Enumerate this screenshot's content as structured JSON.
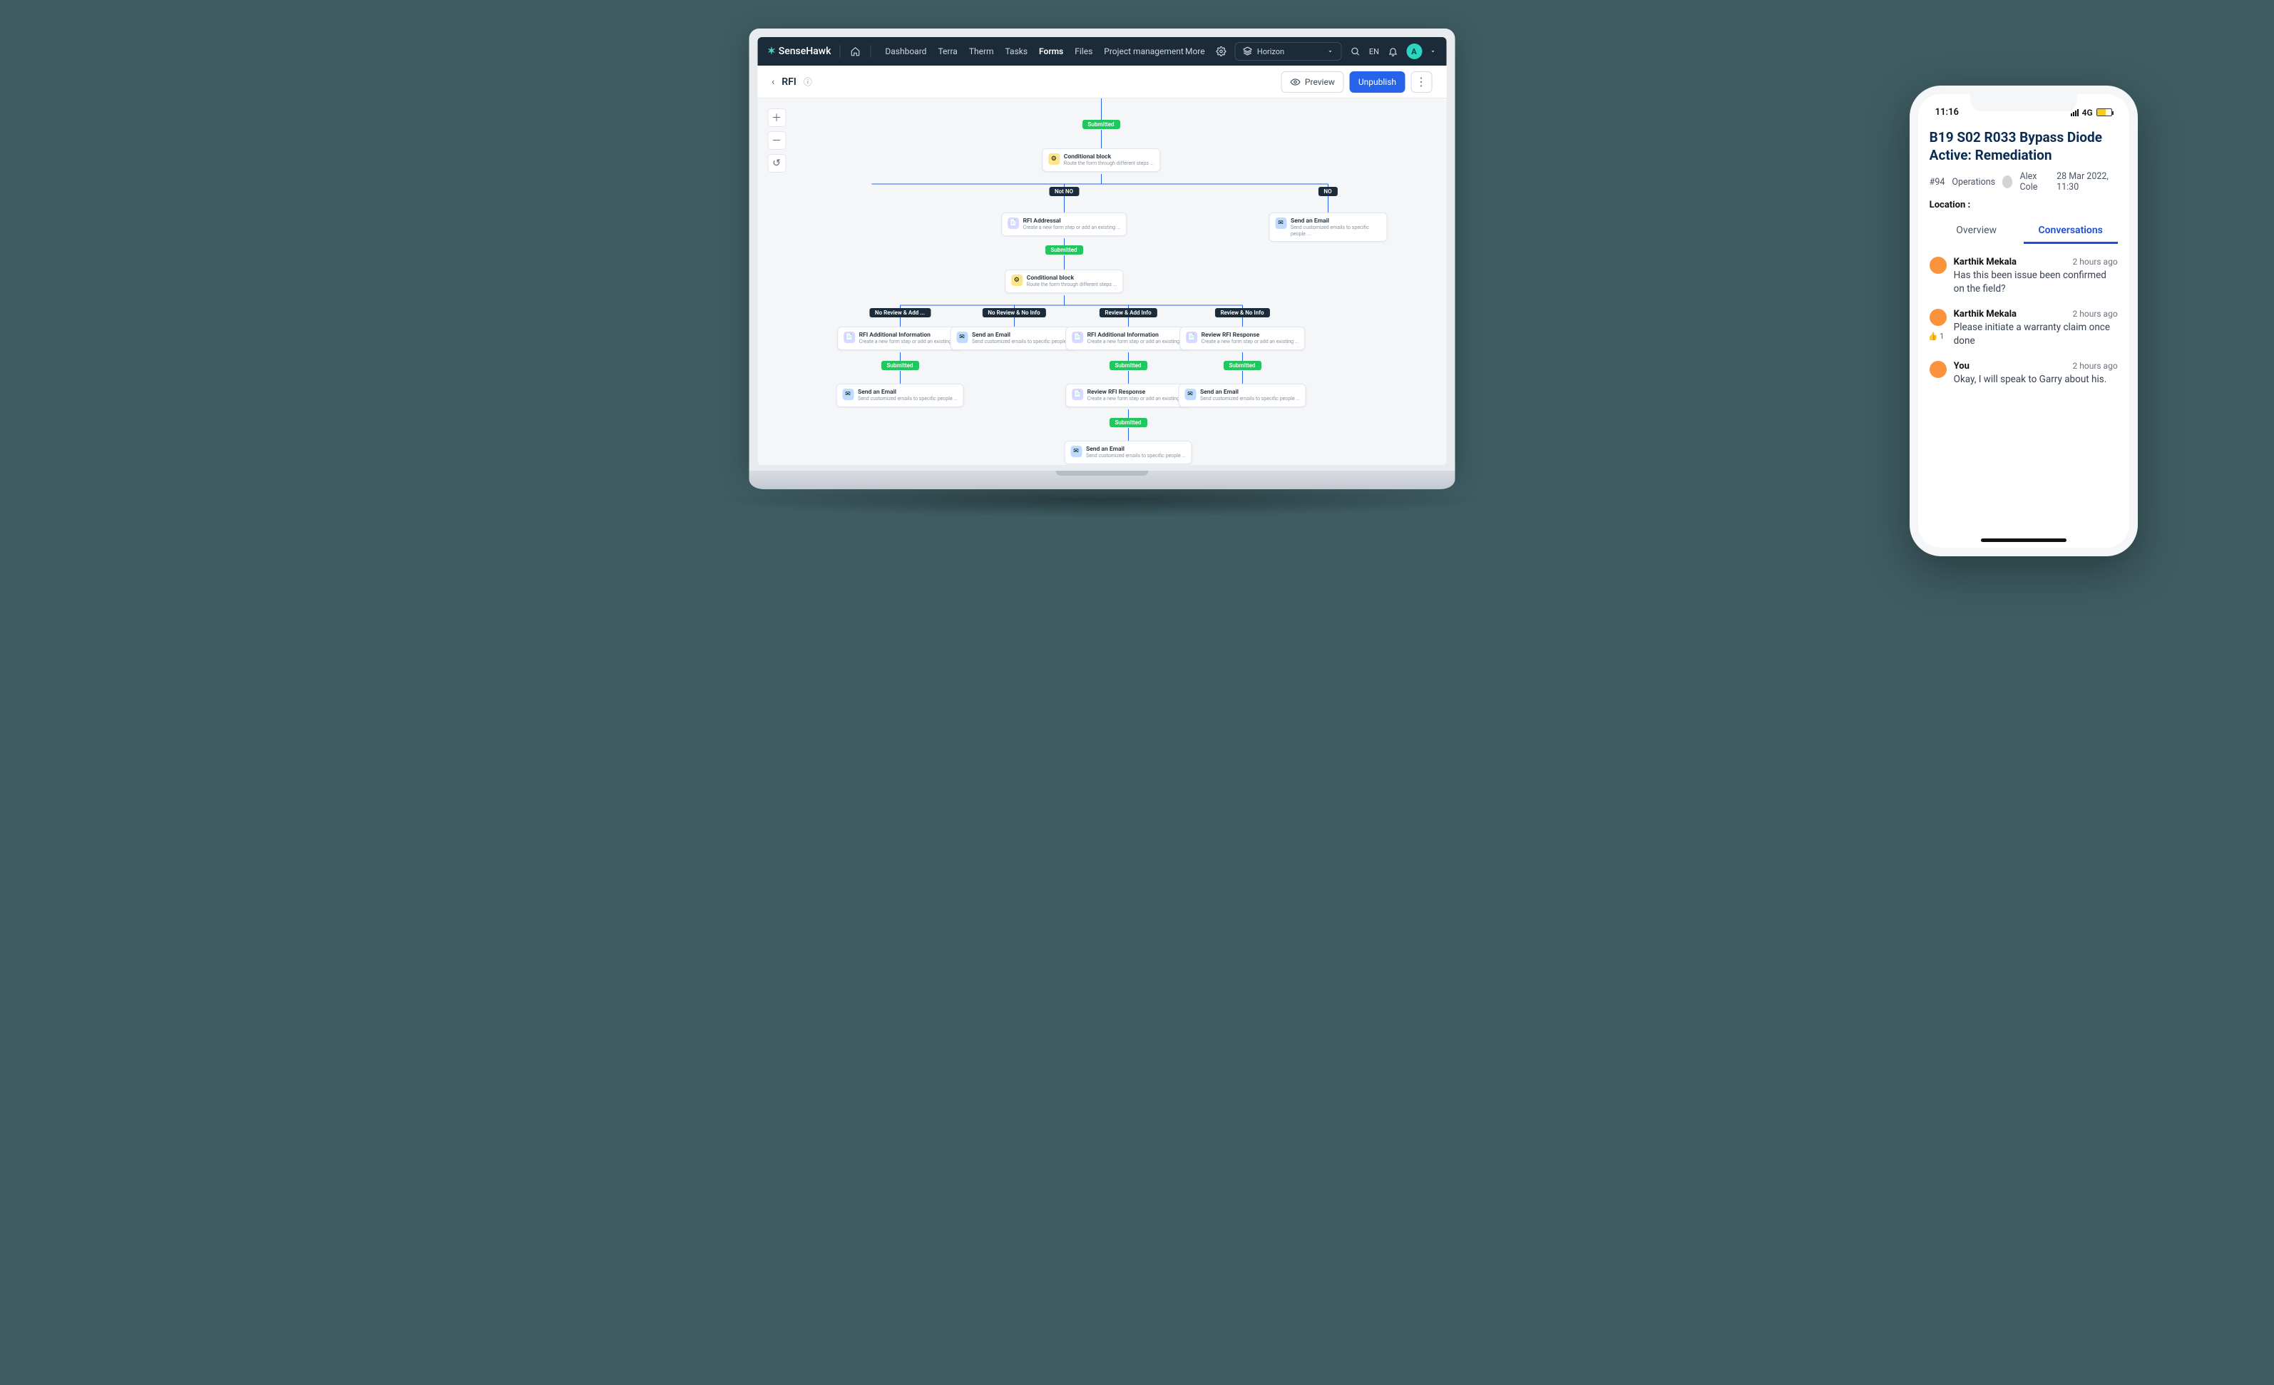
{
  "brand": {
    "name": "SenseHawk"
  },
  "nav": {
    "items": [
      "Dashboard",
      "Terra",
      "Therm",
      "Tasks",
      "Forms",
      "Files",
      "Project management"
    ],
    "more": "More",
    "active": "Forms"
  },
  "header": {
    "asset": "Horizon",
    "lang": "EN",
    "avatar": "A"
  },
  "page": {
    "title": "RFI",
    "preview": "Preview",
    "unpublish": "Unpublish"
  },
  "pills": {
    "submitted": "Submitted",
    "notno": "Not NO",
    "no": "NO",
    "br1": "No Review & Add ...",
    "br2": "No Review & No Info",
    "br3": "Review & Add Info",
    "br4": "Review & No Info"
  },
  "nodes": {
    "cond": {
      "t": "Conditional block",
      "s": "Route the form through different steps ..."
    },
    "addr": {
      "t": "RFI Addressal",
      "s": "Create a new form step or add an existing ..."
    },
    "email": {
      "t": "Send an Email",
      "s": "Send customized emails to specific people ..."
    },
    "addinfo": {
      "t": "RFI Additional Information",
      "s": "Create a new form step or add an existing ..."
    },
    "review": {
      "t": "Review RFI Response",
      "s": "Create a new form step or add an existing ..."
    }
  },
  "phone": {
    "time": "11:16",
    "net": "4G",
    "title": "B19 S02 R033 Bypass Diode Active: Remediation",
    "id": "#94",
    "cat": "Operations",
    "user": "Alex Cole",
    "date": "28 Mar 2022, 11:30",
    "location": "Location :",
    "tabs": {
      "overview": "Overview",
      "conversations": "Conversations"
    },
    "msgs": [
      {
        "u": "Karthik Mekala",
        "t": "2 hours ago",
        "b": "Has this been issue been confirmed on the field?"
      },
      {
        "u": "Karthik Mekala",
        "t": "2 hours ago",
        "b": "Please initiate a warranty claim once done",
        "like": "1"
      },
      {
        "u": "You",
        "t": "2 hours ago",
        "b": "Okay, I will speak to Garry about his."
      }
    ]
  }
}
